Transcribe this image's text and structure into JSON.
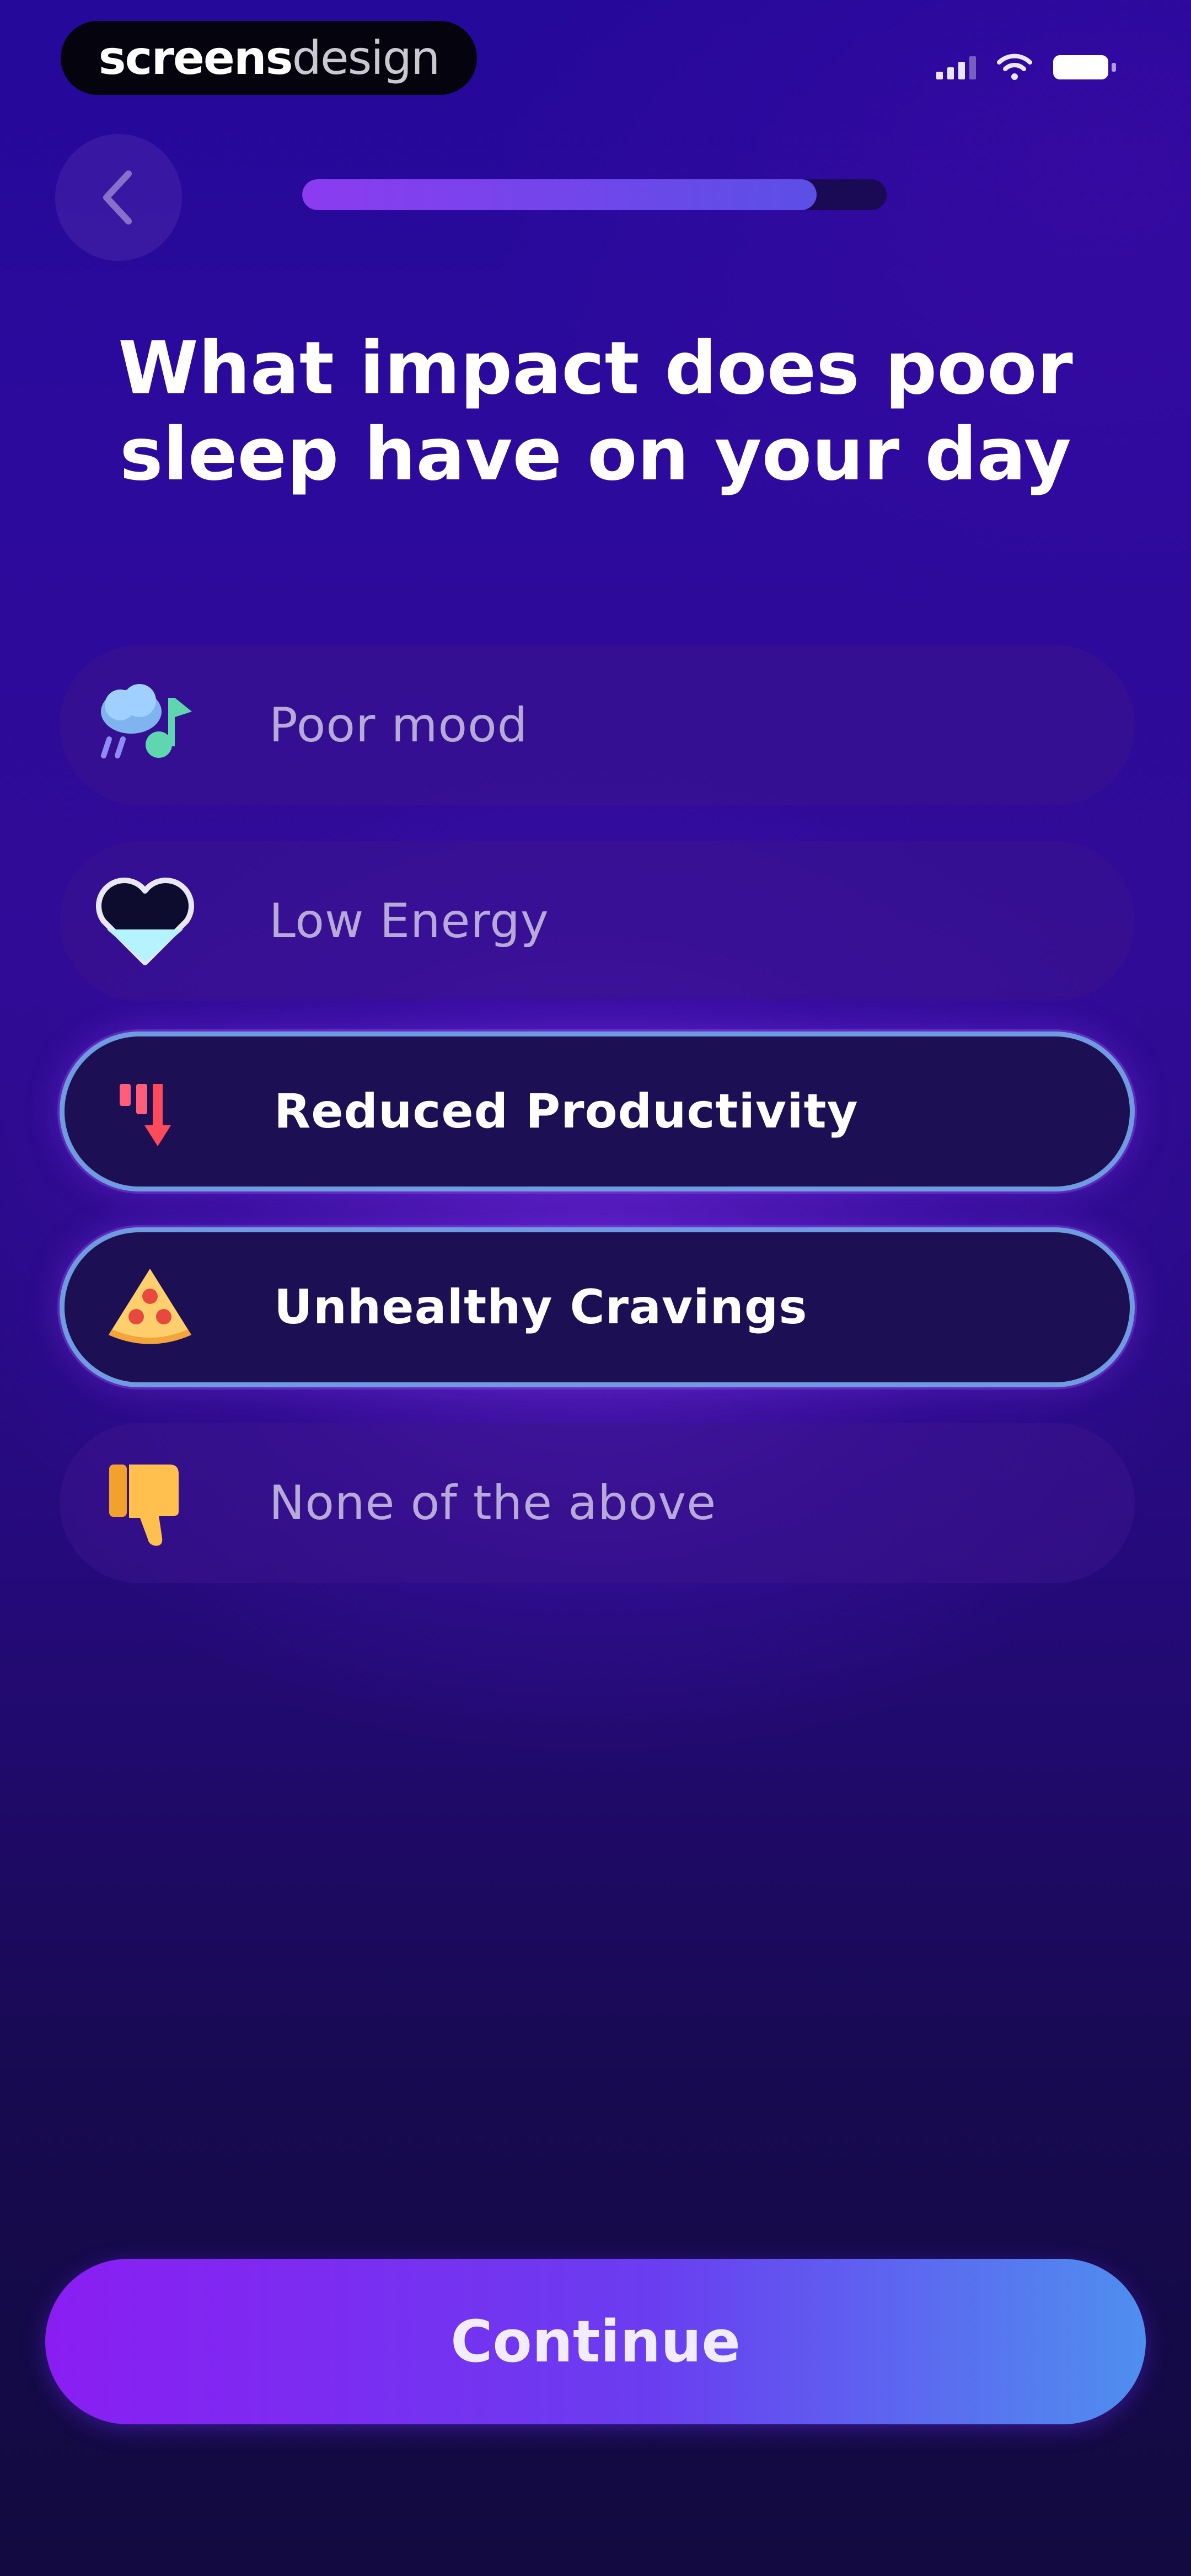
{
  "status_bar": {
    "brand_strong": "screens",
    "brand_light": "design"
  },
  "nav": {
    "back_icon": "chevron-left-icon",
    "progress": 0.88
  },
  "title": "What impact does poor sleep have on your day",
  "options": [
    {
      "label": "Poor mood",
      "icon": "rain-cloud-music-icon",
      "selected": false
    },
    {
      "label": "Low Energy",
      "icon": "low-battery-heart-icon",
      "selected": false
    },
    {
      "label": "Reduced Productivity",
      "icon": "downward-chart-icon",
      "selected": true
    },
    {
      "label": "Unhealthy Cravings",
      "icon": "pizza-slice-icon",
      "selected": true
    },
    {
      "label": "None of the above",
      "icon": "thumbs-down-icon",
      "selected": false
    }
  ],
  "continue_label": "Continue",
  "colors": {
    "selected_border": "#6f9be0",
    "button_start": "#8a1ef2",
    "button_end": "#4f8fef",
    "background": "#2c0a9c"
  }
}
